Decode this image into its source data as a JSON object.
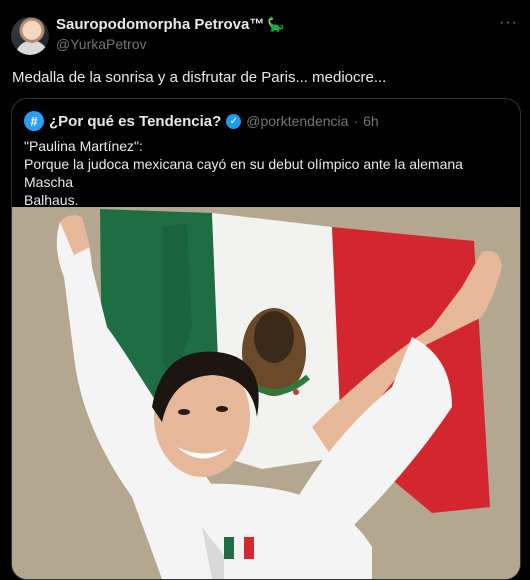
{
  "author": {
    "display_name": "Sauropodomorpha Petrova™",
    "emoji_icon": "dinosaur-icon",
    "handle": "@YurkaPetrov"
  },
  "more_icon": "more-horizontal-icon",
  "tweet_text": "Medalla de la sonrisa y a disfrutar de Paris... mediocre...",
  "quote": {
    "display_name": "¿Por qué es Tendencia?",
    "avatar_glyph": "#",
    "verified_icon": "verified-badge-icon",
    "handle": "@porktendencia",
    "dot": "·",
    "time": "6h",
    "line1": "\"Paulina Martínez\":",
    "line2": "Porque la judoca mexicana cayó en su debut olímpico ante la alemana Mascha",
    "line3": "Balhaus."
  },
  "colors": {
    "background": "#000000",
    "text": "#e7e9ea",
    "muted": "#71767b",
    "border": "#2f3336",
    "verified": "#1d9bf0",
    "flag_green": "#1f6e43",
    "flag_white": "#f2f2f0",
    "flag_red": "#d3262e"
  }
}
